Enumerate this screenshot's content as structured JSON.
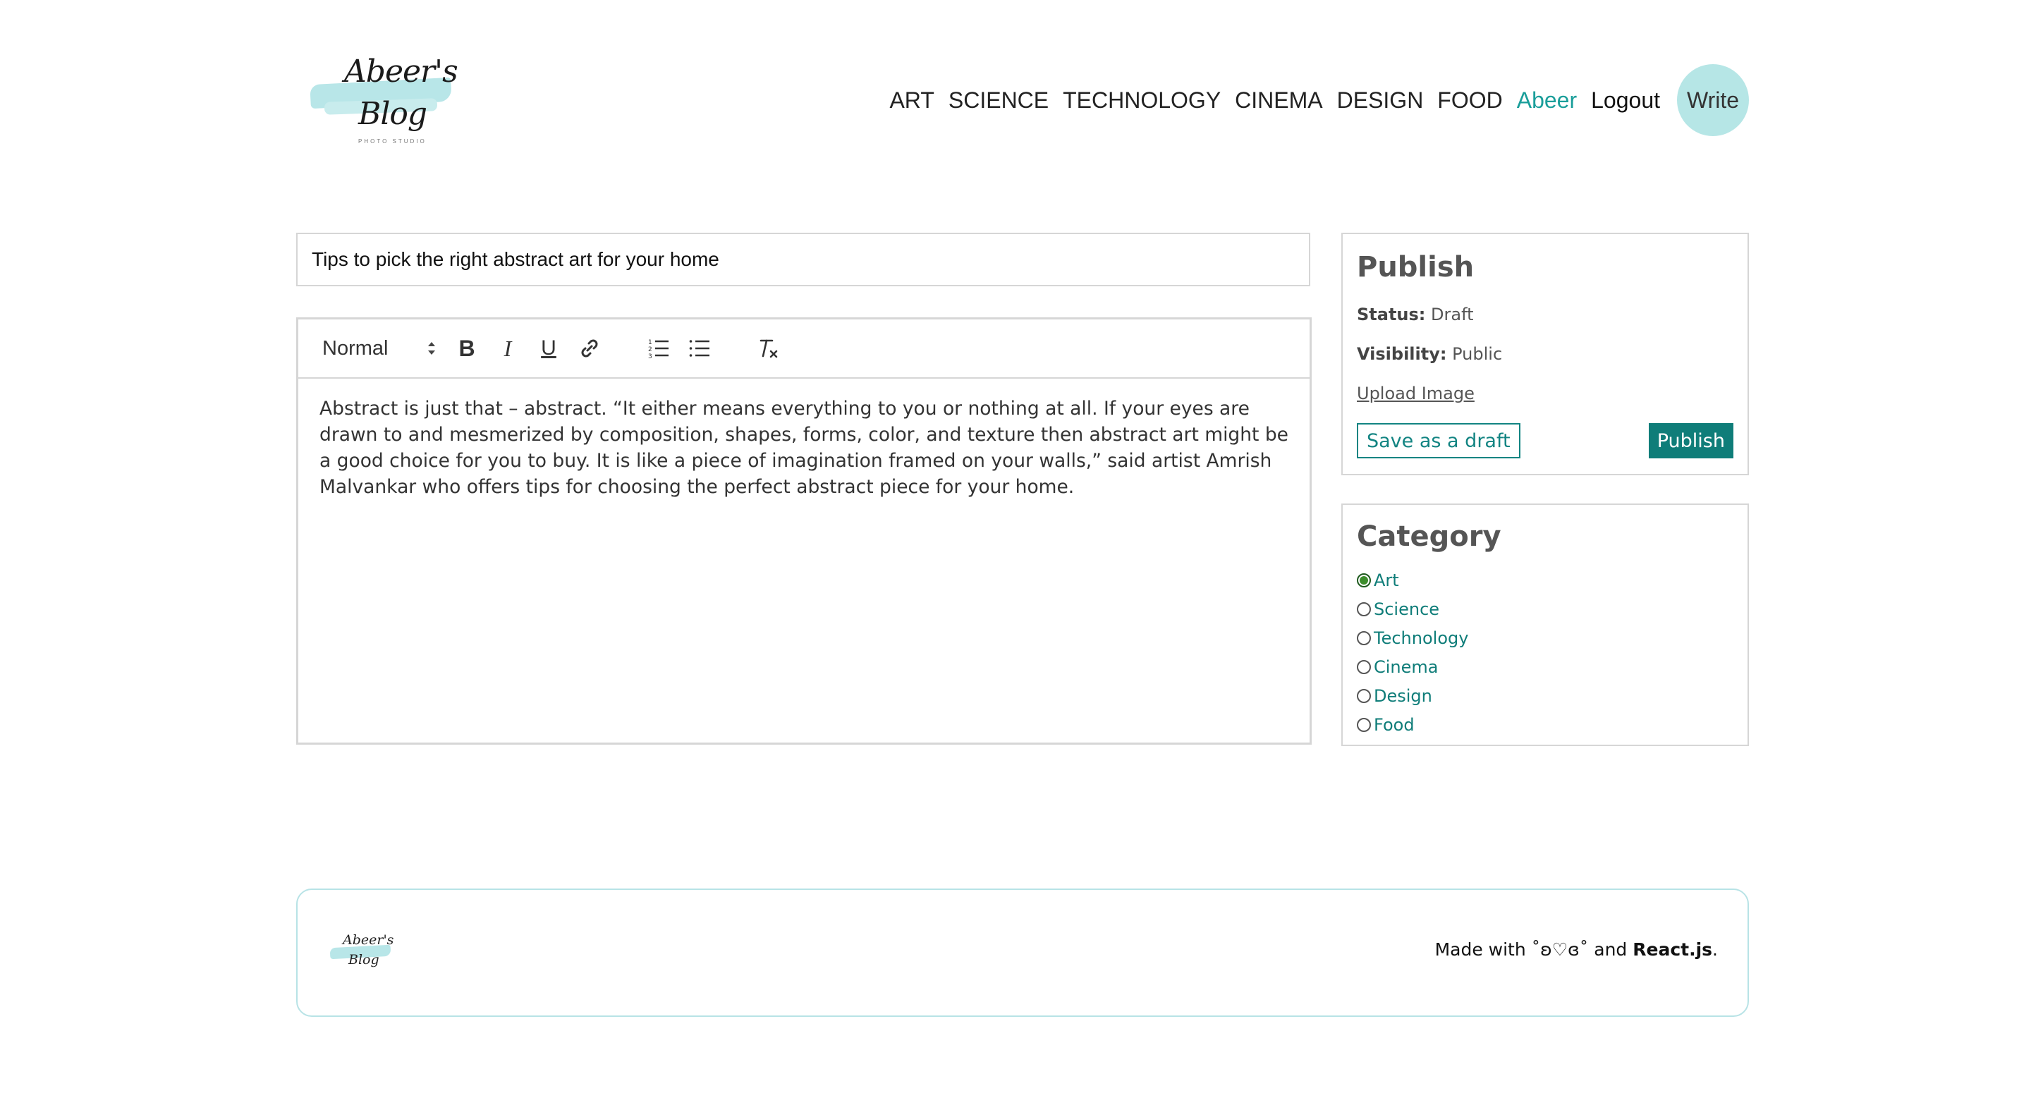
{
  "brand": {
    "logo_line1": "Abeer's",
    "logo_line2": "Blog",
    "logo_tagline": "PHOTO STUDIO"
  },
  "nav": {
    "links": [
      "ART",
      "SCIENCE",
      "TECHNOLOGY",
      "CINEMA",
      "DESIGN",
      "FOOD"
    ],
    "user": "Abeer",
    "logout": "Logout",
    "write": "Write"
  },
  "editor": {
    "title_value": "Tips to pick the right abstract art for your home",
    "format_selected": "Normal",
    "toolbar_icons": [
      "bold-icon",
      "italic-icon",
      "underline-icon",
      "link-icon",
      "ordered-list-icon",
      "bullet-list-icon",
      "clear-format-icon"
    ],
    "bold_glyph": "B",
    "italic_glyph": "I",
    "underline_glyph": "U",
    "body": "Abstract is just that – abstract. “It either means everything to you or nothing at all. If your eyes are drawn to and mesmerized by composition, shapes, forms, color, and texture then abstract art might be a good choice for you to buy. It is like a piece of imagination framed on your walls,” said artist Amrish Malvankar who offers tips for choosing the perfect abstract piece for your home."
  },
  "publish": {
    "heading": "Publish",
    "status_label": "Status:",
    "status_value": "Draft",
    "visibility_label": "Visibility:",
    "visibility_value": "Public",
    "upload_label": "Upload Image",
    "draft_button": "Save as a draft",
    "publish_button": "Publish"
  },
  "category": {
    "heading": "Category",
    "options": [
      "Art",
      "Science",
      "Technology",
      "Cinema",
      "Design",
      "Food"
    ],
    "selected": "Art"
  },
  "footer": {
    "logo_line1": "Abeer's",
    "logo_line2": "Blog",
    "made_with": "Made with",
    "emoticon": "˚ʚ♡ɞ˚",
    "and": "and",
    "tech": "React.js",
    "period": "."
  },
  "colors": {
    "accent": "#0f7d79",
    "nav_user": "#1a9e9a",
    "write_bg": "#b6e6e6",
    "footer_border": "#b8e3e6"
  }
}
